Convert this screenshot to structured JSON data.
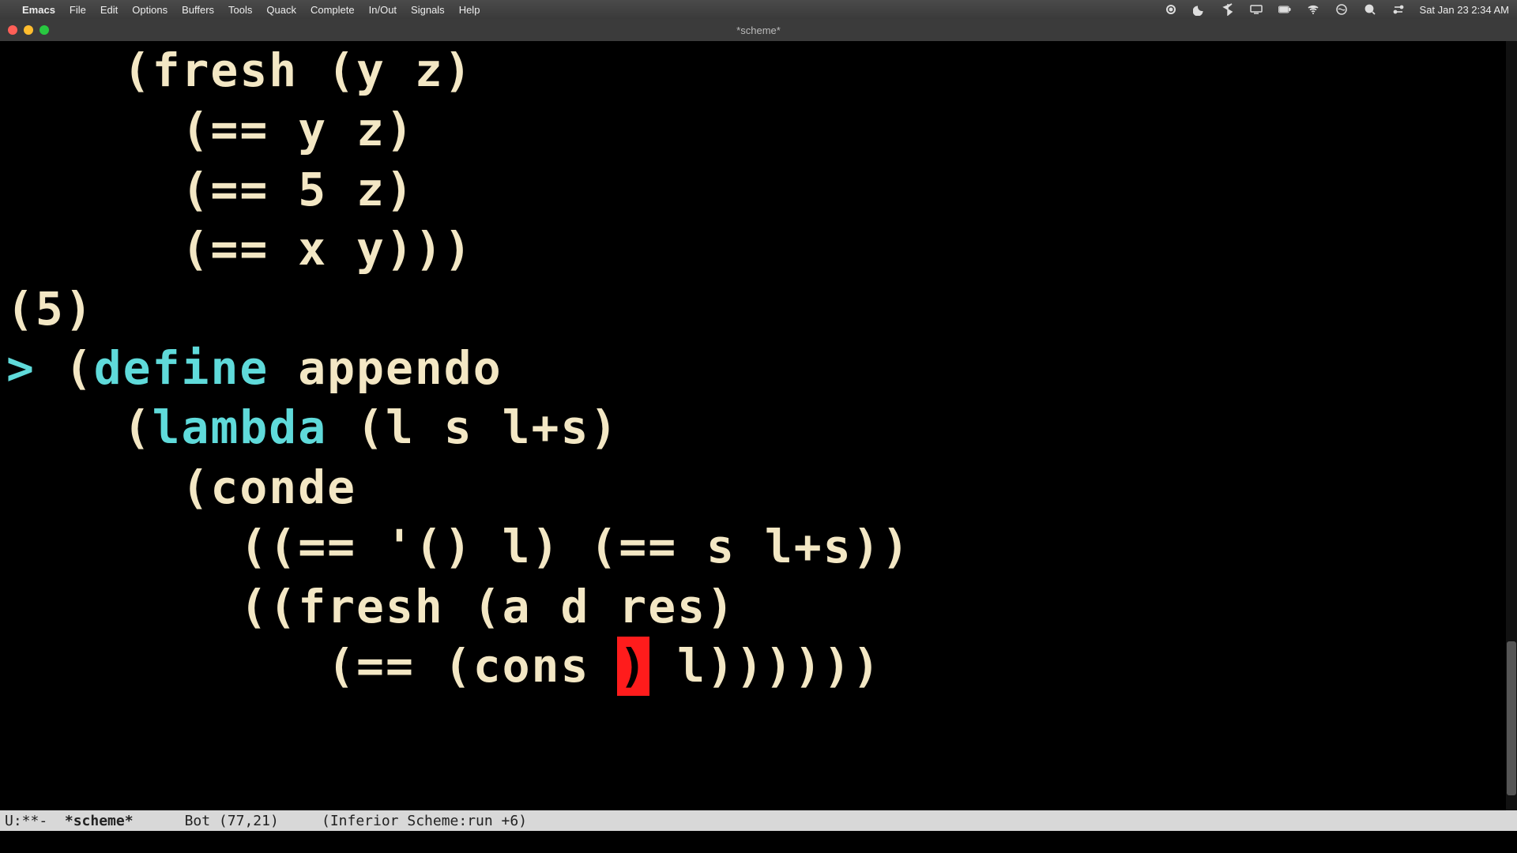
{
  "menubar": {
    "app": "Emacs",
    "items": [
      "File",
      "Edit",
      "Options",
      "Buffers",
      "Tools",
      "Quack",
      "Complete",
      "In/Out",
      "Signals",
      "Help"
    ],
    "clock": "Sat Jan 23  2:34 AM"
  },
  "window": {
    "title": "*scheme*"
  },
  "code": {
    "l1": "    (fresh (y z)",
    "l2": "      (== y z)",
    "l3": "      (== 5 z)",
    "l4": "      (== x y)))",
    "l5": "(5)",
    "l6_prompt": "> ",
    "l6a": "(",
    "l6_kw1": "define",
    "l6b": " appendo",
    "l7a": "    (",
    "l7_kw": "lambda",
    "l7b": " (l s l+s)",
    "l8": "      (conde",
    "l9": "        ((== '() l) (== s l+s))",
    "l10": "        ((fresh (a d res)",
    "l11a": "           (== (cons ",
    "l11_cursor": ")",
    "l11b": " l))))))"
  },
  "modeline": {
    "left": "U:**-  ",
    "buffer": "*scheme*",
    "pos": "      Bot (77,21)     ",
    "mode": "(Inferior Scheme:run +6)"
  },
  "minibuffer": ""
}
